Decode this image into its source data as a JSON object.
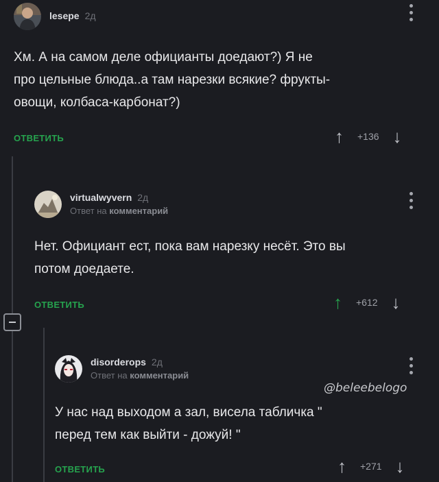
{
  "comments": [
    {
      "author": "lesepe",
      "time": "2д",
      "text_lines": [
        "Хм. А на самом деле официанты доедают?) Я не",
        "про цельные блюда..а там нарезки всякие? фрукты-",
        "овощи, колбаса-карбонат?)"
      ],
      "reply_label": "ОТВЕТИТЬ",
      "rating": "+136"
    },
    {
      "author": "virtualwyvern",
      "time": "2д",
      "reply_to_prefix": "Ответ на",
      "reply_to_link": "комментарий",
      "text_lines": [
        "Нет. Официант ест, пока вам нарезку несёт. Это вы",
        "потом доедаете."
      ],
      "reply_label": "ОТВЕТИТЬ",
      "rating": "+612"
    },
    {
      "author": "disorderops",
      "time": "2д",
      "reply_to_prefix": "Ответ на",
      "reply_to_link": "комментарий",
      "text_lines": [
        "У нас над выходом а зал, висела табличка \"",
        "перед тем как выйти - дожуй! \""
      ],
      "reply_label": "ОТВЕТИТЬ",
      "rating": "+271"
    }
  ],
  "watermark": "@beleebelogo",
  "icons": {
    "upvote": "arrow-up-icon",
    "downvote": "arrow-down-icon",
    "menu": "kebab-menu-icon",
    "collapse": "collapse-thread-icon"
  },
  "colors": {
    "background": "#1b1c21",
    "accent_green": "#26a34e",
    "muted_text": "#6f7178"
  }
}
